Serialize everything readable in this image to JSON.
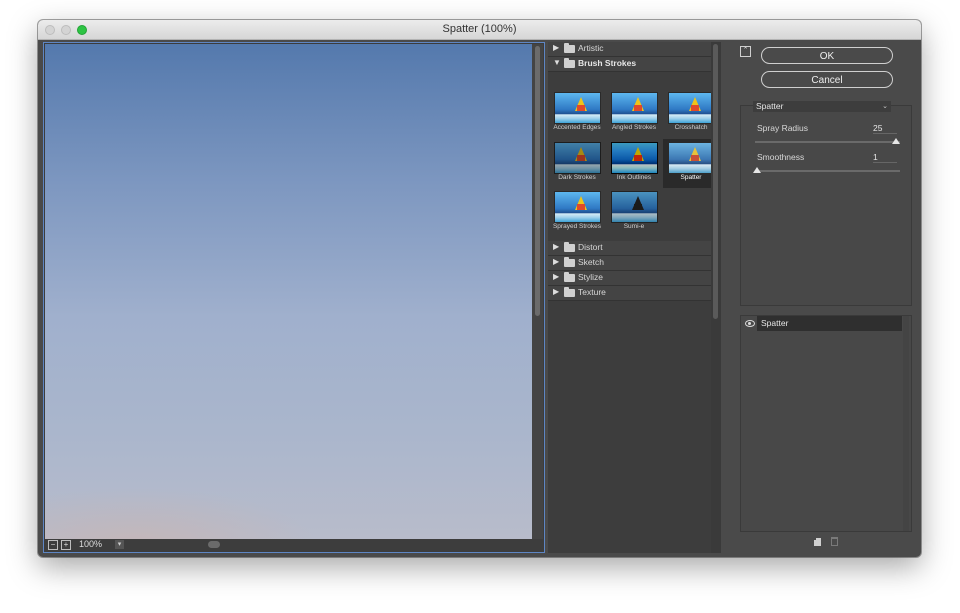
{
  "window": {
    "title": "Spatter (100%)"
  },
  "preview": {
    "zoom": "100%",
    "zoom_out_symbol": "−",
    "zoom_in_symbol": "+"
  },
  "gallery": {
    "categories": [
      {
        "label": "Artistic",
        "expanded": false
      },
      {
        "label": "Brush Strokes",
        "expanded": true
      },
      {
        "label": "Distort",
        "expanded": false
      },
      {
        "label": "Sketch",
        "expanded": false
      },
      {
        "label": "Stylize",
        "expanded": false
      },
      {
        "label": "Texture",
        "expanded": false
      }
    ],
    "thumbnails": [
      {
        "label": "Accented Edges",
        "selected": false
      },
      {
        "label": "Angled Strokes",
        "selected": false
      },
      {
        "label": "Crosshatch",
        "selected": false
      },
      {
        "label": "Dark Strokes",
        "selected": false
      },
      {
        "label": "Ink Outlines",
        "selected": false
      },
      {
        "label": "Spatter",
        "selected": true
      },
      {
        "label": "Sprayed Strokes",
        "selected": false
      },
      {
        "label": "Sumi-e",
        "selected": false
      }
    ]
  },
  "buttons": {
    "ok": "OK",
    "cancel": "Cancel"
  },
  "settings": {
    "filter": "Spatter",
    "params": [
      {
        "label": "Spray Radius",
        "value": "25",
        "fraction": 1.0
      },
      {
        "label": "Smoothness",
        "value": "1",
        "fraction": 0.0
      }
    ]
  },
  "layers": [
    {
      "label": "Spatter",
      "visible": true
    }
  ],
  "colors": {
    "accent_border": "#5e86c4",
    "panel_bg": "#4a4a4a",
    "sky_top": "#5479ad",
    "sky_bottom": "#b8bccb"
  }
}
